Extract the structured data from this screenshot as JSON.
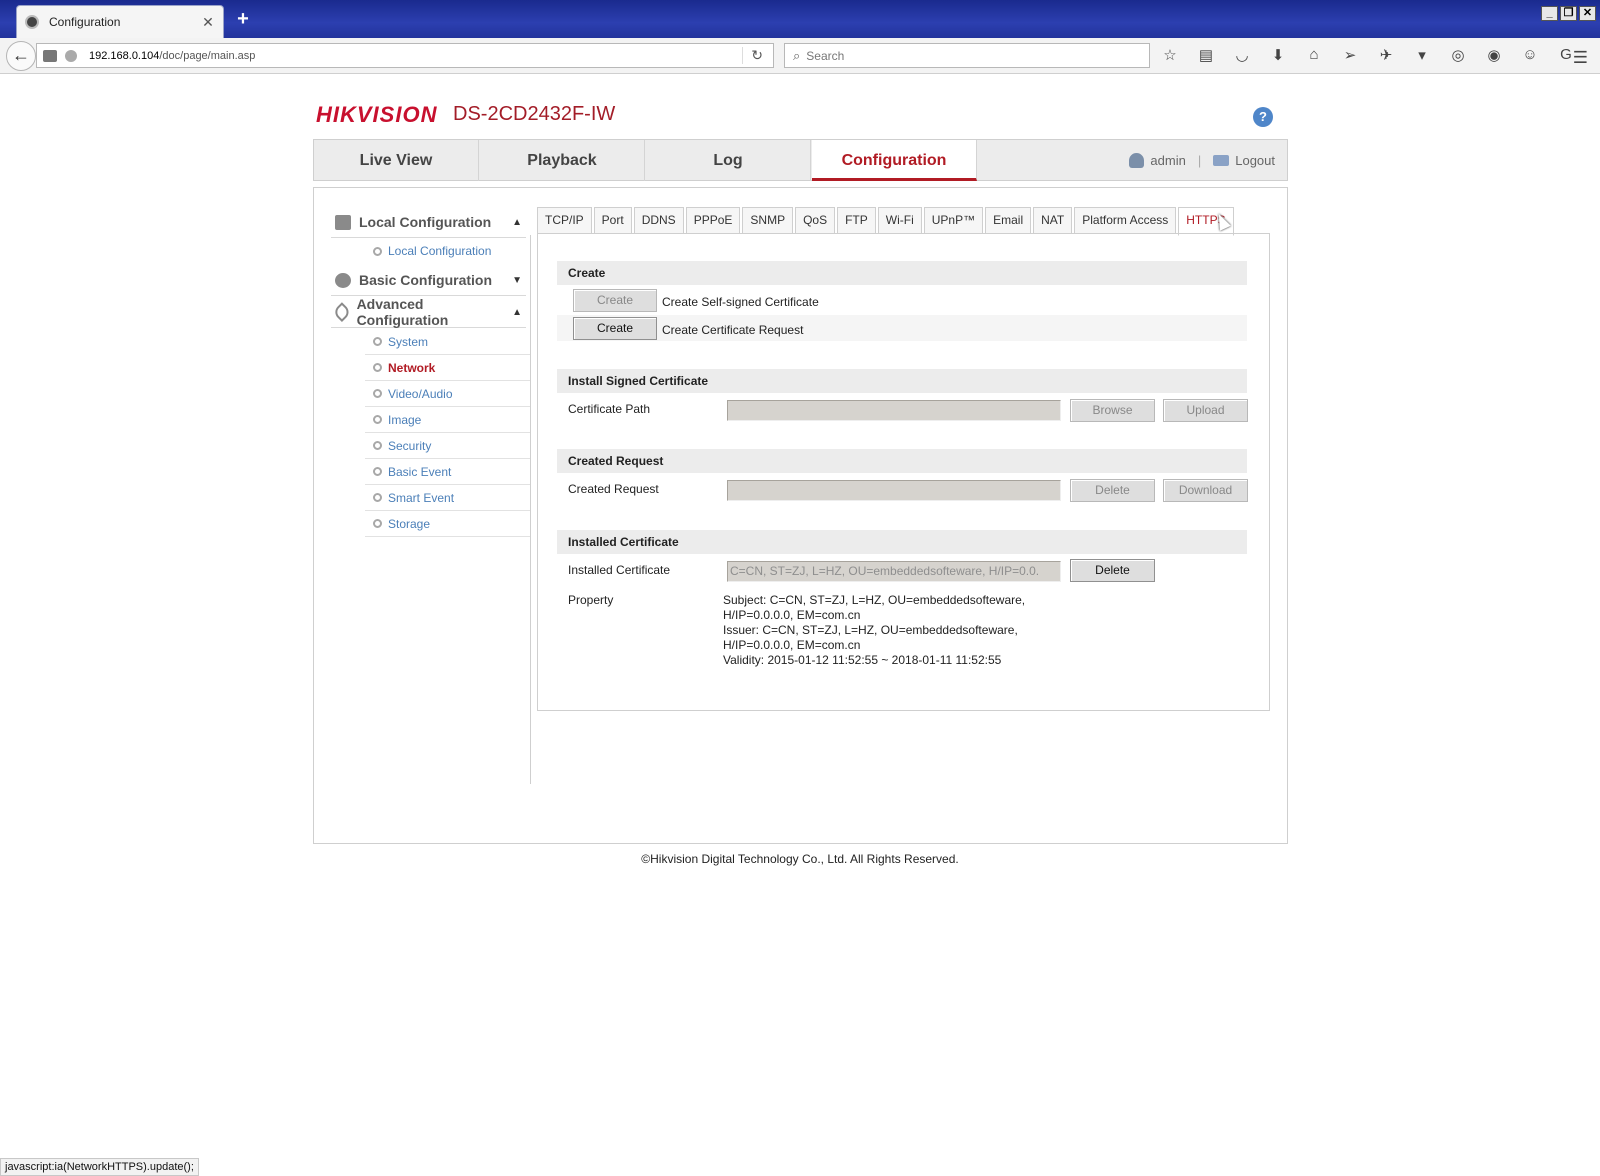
{
  "browser": {
    "tab_title": "Configuration",
    "tab_close": "✕",
    "new_tab": "+",
    "url_host": "192.168.0.104",
    "url_path": "/doc/page/main.asp",
    "search_placeholder": "Search",
    "status_text": "javascript:ia(NetworkHTTPS).update();"
  },
  "header": {
    "logo": "HIKVISION",
    "model": "DS-2CD2432F-IW",
    "help": "?"
  },
  "main_nav": {
    "items": [
      "Live View",
      "Playback",
      "Log",
      "Configuration"
    ],
    "active": "Configuration",
    "user": "admin",
    "separator": "|",
    "logout": "Logout"
  },
  "sidebar": {
    "local_group": "Local Configuration",
    "local_items": [
      "Local Configuration"
    ],
    "basic_group": "Basic Configuration",
    "advanced_group": "Advanced Configuration",
    "advanced_items": [
      "System",
      "Network",
      "Video/Audio",
      "Image",
      "Security",
      "Basic Event",
      "Smart Event",
      "Storage"
    ],
    "active_item": "Network"
  },
  "subtabs": {
    "items": [
      "TCP/IP",
      "Port",
      "DDNS",
      "PPPoE",
      "SNMP",
      "QoS",
      "FTP",
      "Wi-Fi",
      "UPnP™",
      "Email",
      "NAT",
      "Platform Access",
      "HTTPS"
    ],
    "active": "HTTPS"
  },
  "https": {
    "create": {
      "title": "Create",
      "self_signed_button": "Create",
      "self_signed_label": "Create Self-signed Certificate",
      "request_button": "Create",
      "request_label": "Create Certificate Request"
    },
    "install_signed": {
      "title": "Install Signed Certificate",
      "path_label": "Certificate Path",
      "path_value": "",
      "browse_button": "Browse",
      "upload_button": "Upload"
    },
    "created_request": {
      "title": "Created Request",
      "label": "Created Request",
      "value": "",
      "delete_button": "Delete",
      "download_button": "Download"
    },
    "installed": {
      "title": "Installed Certificate",
      "label": "Installed Certificate",
      "value": "C=CN, ST=ZJ, L=HZ, OU=embeddedsofteware, H/IP=0.0.",
      "delete_button": "Delete",
      "property_label": "Property",
      "property_lines": [
        "Subject: C=CN, ST=ZJ, L=HZ, OU=embeddedsofteware,",
        "H/IP=0.0.0.0, EM=com.cn",
        "Issuer: C=CN, ST=ZJ, L=HZ, OU=embeddedsofteware,",
        "H/IP=0.0.0.0, EM=com.cn",
        "Validity: 2015-01-12 11:52:55 ~ 2018-01-11 11:52:55"
      ]
    }
  },
  "footer": "©Hikvision Digital Technology Co., Ltd. All Rights Reserved."
}
